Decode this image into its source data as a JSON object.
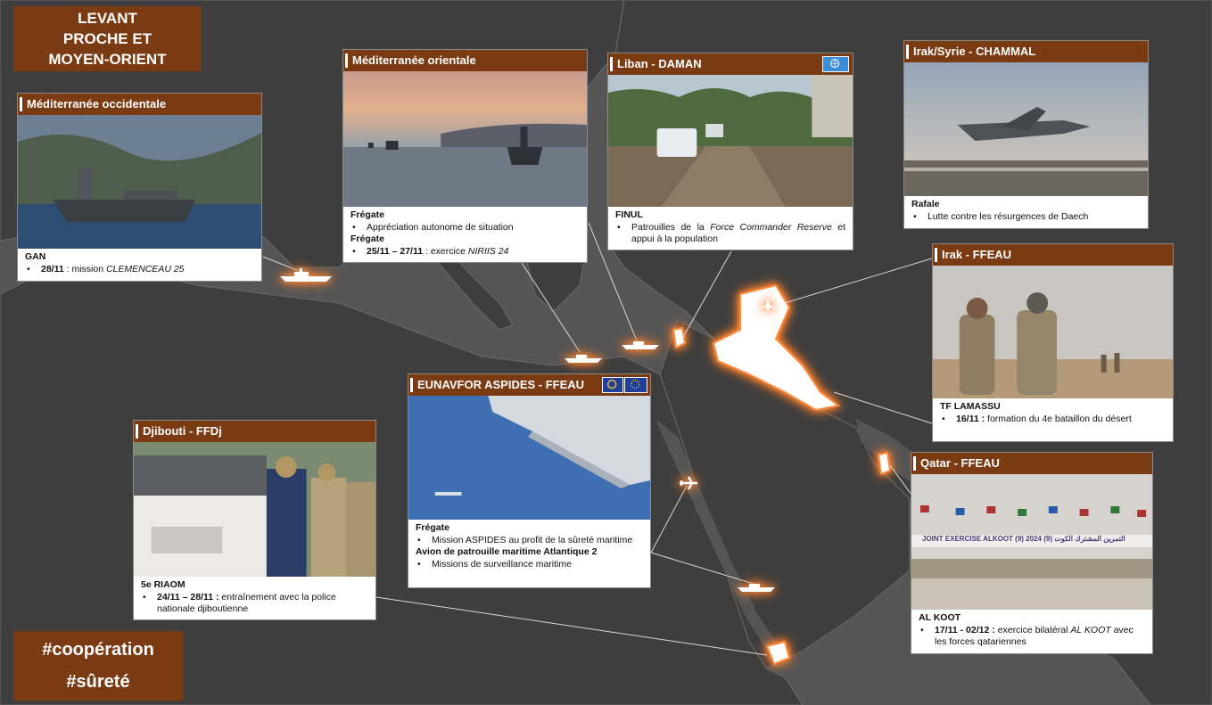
{
  "title": {
    "line1": "LEVANT",
    "line2": "PROCHE ET",
    "line3": "MOYEN-ORIENT"
  },
  "hashtags": [
    "#coopération",
    "#sûreté"
  ],
  "colors": {
    "brown": "#7a3a12",
    "map_land": "#3e3e3e",
    "map_sea": "#555555",
    "glow": "#ff7a20",
    "eu_blue": "#1f3f9a",
    "un_blue": "#3b8fd8"
  },
  "panels": {
    "med_occ": {
      "title": "Méditerranée occidentale",
      "label": "GAN",
      "b1_date": "28/11",
      "b1_text": " : mission ",
      "b1_em": "CLEMENCEAU 25"
    },
    "med_or": {
      "title": "Méditerranée orientale",
      "label1": "Frégate",
      "b1": "Appréciation autonome de situation",
      "label2": "Frégate",
      "b2_date": "25/11 – 27/11",
      "b2_text": " : exercice ",
      "b2_em": "NIRIIS 24"
    },
    "liban": {
      "title": "Liban - DAMAN",
      "flag_icon": "un-flag-icon",
      "label": "FINUL",
      "b1_pre": "Patrouilles de la ",
      "b1_em": "Force Commander Reserve",
      "b1_post": " et appui à la population"
    },
    "irak_syrie": {
      "title": "Irak/Syrie - CHAMMAL",
      "label": "Rafale",
      "b1": "Lutte contre les résurgences de Daech"
    },
    "irak": {
      "title": "Irak - FFEAU",
      "label": "TF LAMASSU",
      "b1_date": "16/11 :",
      "b1_text": " formation du 4e bataillon du désert"
    },
    "aspides": {
      "title": "EUNAVFOR ASPIDES - FFEAU",
      "label1": "Frégate",
      "b1": "Mission ASPIDES au profit de la sûreté maritime",
      "label2": "Avion de patrouille maritime Atlantique 2",
      "b2": "Missions de surveillance maritime"
    },
    "djibouti": {
      "title": "Djibouti - FFDj",
      "label": "5e RIAOM",
      "b1_date": "24/11 – 28/11 :",
      "b1_text": " entraînement avec la police nationale djiboutienne"
    },
    "qatar": {
      "title": "Qatar - FFEAU",
      "banner_text": "JOINT EXERCISE ALKOOT (9)   2024   التمرين المشترك الكوت (9)",
      "label": "AL KOOT",
      "b1_date": "17/11 - 02/12 :",
      "b1_text": " exercice bilatéral ",
      "b1_em": "AL KOOT",
      "b1_post": " avec les forces qatariennes"
    }
  }
}
